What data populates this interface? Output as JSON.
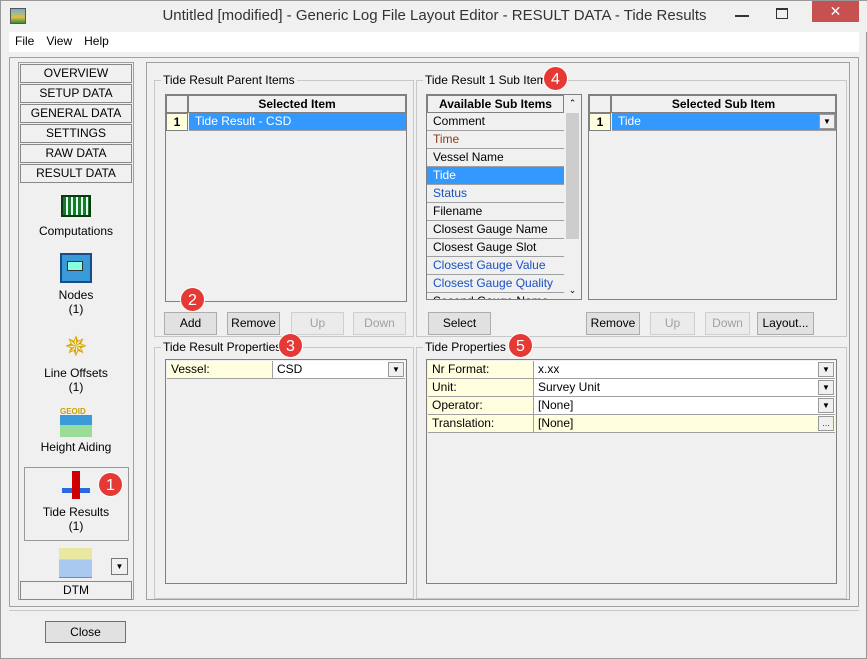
{
  "window": {
    "title": "Untitled [modified] - Generic Log File Layout Editor -  RESULT DATA -  Tide Results",
    "close_glyph": "✕"
  },
  "menu": [
    "File",
    "View",
    "Help"
  ],
  "nav": {
    "buttons": [
      "OVERVIEW",
      "SETUP DATA",
      "GENERAL DATA",
      "SETTINGS",
      "RAW DATA",
      "RESULT DATA"
    ],
    "items": [
      {
        "label": "Computations",
        "count": ""
      },
      {
        "label": "Nodes",
        "count": "(1)"
      },
      {
        "label": "Line Offsets",
        "count": "(1)"
      },
      {
        "label": "Height Aiding",
        "count": ""
      },
      {
        "label": "Tide Results",
        "count": "(1)"
      }
    ],
    "bottom_button": "DTM",
    "geoid_text": "GEOID"
  },
  "parent_items": {
    "title": "Tide Result Parent Items",
    "header": "Selected Item",
    "rows": [
      {
        "num": "1",
        "value": "Tide Result  -  CSD"
      }
    ],
    "buttons": {
      "add": "Add",
      "remove": "Remove",
      "up": "Up",
      "down": "Down"
    }
  },
  "sub_items": {
    "title": "Tide Result 1 Sub Items",
    "available_header": "Available Sub Items",
    "available": [
      {
        "label": "Comment",
        "color": "#000000"
      },
      {
        "label": "Time",
        "color": "#8b3a1a"
      },
      {
        "label": "Vessel Name",
        "color": "#000000"
      },
      {
        "label": "Tide",
        "color": "#ffffff",
        "selected": true
      },
      {
        "label": "Status",
        "color": "#1a4fc4"
      },
      {
        "label": "Filename",
        "color": "#000000"
      },
      {
        "label": "Closest Gauge Name",
        "color": "#000000"
      },
      {
        "label": "Closest Gauge Slot",
        "color": "#000000"
      },
      {
        "label": "Closest Gauge Value",
        "color": "#1a4fc4"
      },
      {
        "label": "Closest Gauge Quality",
        "color": "#1a4fc4"
      },
      {
        "label": "Second Gauge Name",
        "color": "#000000"
      }
    ],
    "selected_header": "Selected Sub Item",
    "selected_rows": [
      {
        "num": "1",
        "value": "Tide"
      }
    ],
    "buttons": {
      "select": "Select",
      "remove": "Remove",
      "up": "Up",
      "down": "Down",
      "layout": "Layout..."
    }
  },
  "result_props": {
    "title": "Tide Result Properties",
    "rows": [
      {
        "label": "Vessel:",
        "value": "CSD"
      }
    ]
  },
  "tide_props": {
    "title": "Tide Properties",
    "rows": [
      {
        "label": "Nr Format:",
        "value": "x.xx"
      },
      {
        "label": "Unit:",
        "value": "Survey Unit"
      },
      {
        "label": "Operator:",
        "value": "[None]"
      },
      {
        "label": "Translation:",
        "value": "[None]"
      }
    ]
  },
  "badges": [
    "1",
    "2",
    "3",
    "4",
    "5"
  ],
  "footer": {
    "close": "Close"
  },
  "colors": {
    "selection": "#3399ff",
    "badge": "#e53935",
    "label_bg": "#ffffe0"
  }
}
